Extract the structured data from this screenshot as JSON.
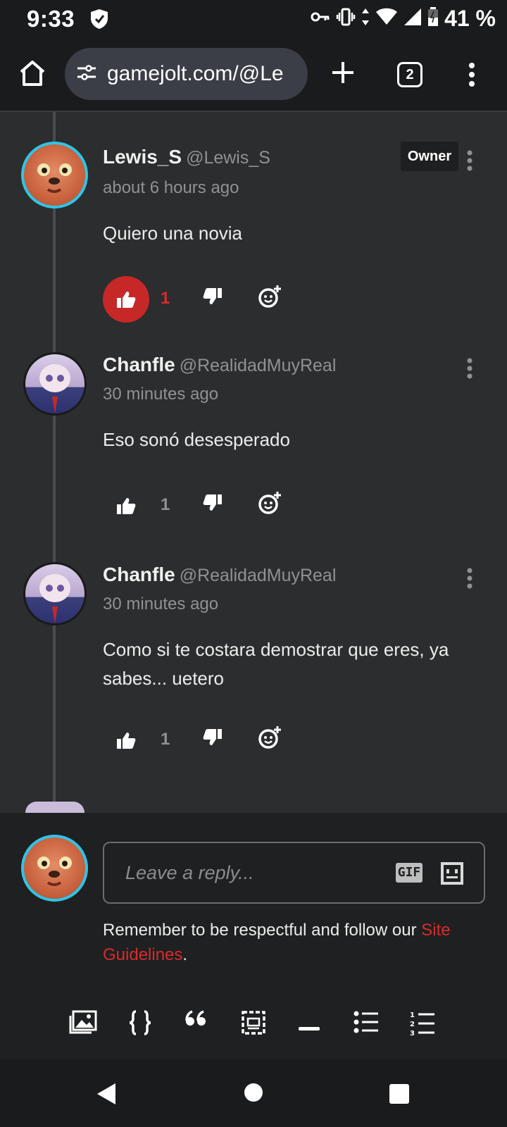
{
  "status_bar": {
    "time": "9:33",
    "battery": "41 %",
    "icons": [
      "shield-icon",
      "key-icon",
      "vibrate-icon",
      "data-arrows-icon",
      "wifi-icon",
      "signal-icon",
      "battery-icon"
    ]
  },
  "browser": {
    "url": "gamejolt.com/@Le",
    "tab_count": "2",
    "icons": [
      "home-icon",
      "site-settings-icon",
      "new-tab-icon",
      "tabs-icon",
      "menu-icon"
    ]
  },
  "comments": [
    {
      "author": "Lewis_S",
      "handle": "@Lewis_S",
      "time": "about 6 hours ago",
      "text": "Quiero una novia",
      "badge": "Owner",
      "likes": "1",
      "liked": true
    },
    {
      "author": "Chanfle",
      "handle": "@RealidadMuyReal",
      "time": "30 minutes ago",
      "text": "Eso sonó desesperado",
      "likes": "1",
      "liked": false
    },
    {
      "author": "Chanfle",
      "handle": "@RealidadMuyReal",
      "time": "30 minutes ago",
      "text": "Como si te costara demostrar que eres, ya sabes... uetero",
      "likes": "1",
      "liked": false
    }
  ],
  "composer": {
    "placeholder": "Leave a reply...",
    "gif_label": "GIF",
    "guidelines_prefix": "Remember to be respectful and follow our ",
    "guidelines_link": "Site Guidelines",
    "guidelines_suffix": ".",
    "toolbar": [
      "image-icon",
      "code-icon",
      "quote-icon",
      "spoiler-icon",
      "divider-icon",
      "bullet-list-icon",
      "numbered-list-icon"
    ]
  },
  "colors": {
    "accent_red": "#c62828",
    "avatar_ring": "#2ec5e8",
    "background": "#2b2d2e"
  }
}
